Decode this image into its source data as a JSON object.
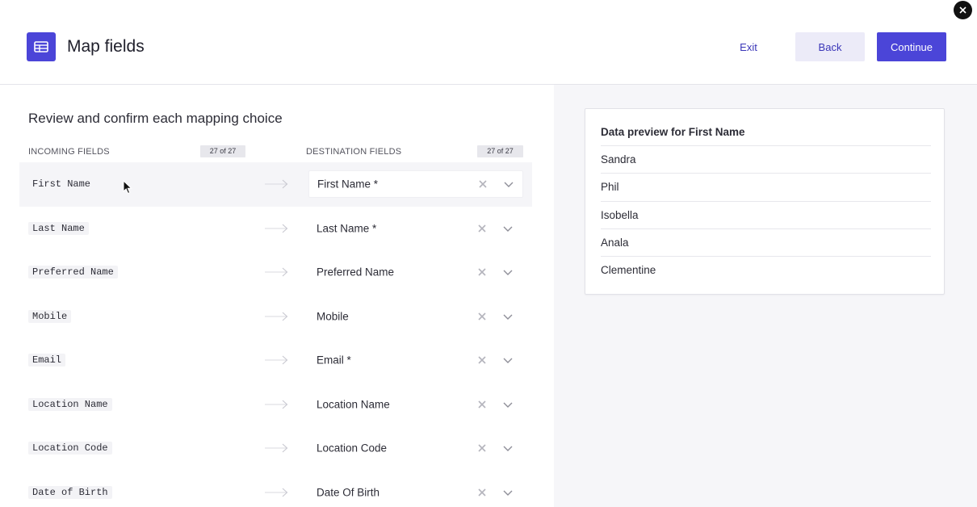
{
  "header": {
    "title": "Map fields",
    "icon": "table-icon",
    "exit_label": "Exit",
    "back_label": "Back",
    "continue_label": "Continue",
    "close_icon": "close-icon"
  },
  "mapping": {
    "section_title": "Review and confirm each mapping choice",
    "incoming_header": "INCOMING FIELDS",
    "incoming_count": "27 of 27",
    "destination_header": "DESTINATION FIELDS",
    "destination_count": "27 of 27",
    "rows": [
      {
        "incoming": "First Name",
        "destination": "First Name *"
      },
      {
        "incoming": "Last Name",
        "destination": "Last Name *"
      },
      {
        "incoming": "Preferred Name",
        "destination": "Preferred Name"
      },
      {
        "incoming": "Mobile",
        "destination": "Mobile"
      },
      {
        "incoming": "Email",
        "destination": "Email *"
      },
      {
        "incoming": "Location Name",
        "destination": "Location Name"
      },
      {
        "incoming": "Location Code",
        "destination": "Location Code"
      },
      {
        "incoming": "Date of Birth",
        "destination": "Date Of Birth"
      }
    ]
  },
  "preview": {
    "title": "Data preview for First Name",
    "values": [
      "Sandra",
      "Phil",
      "Isobella",
      "Anala",
      "Clementine"
    ]
  },
  "colors": {
    "accent": "#4b45d8",
    "accent_light": "#ecebf8",
    "panel_bg": "#f6f6f9"
  }
}
